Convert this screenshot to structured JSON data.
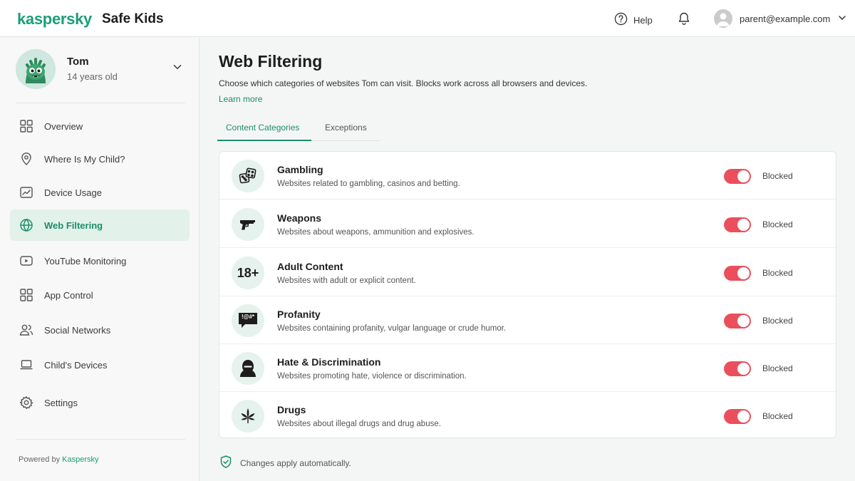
{
  "header": {
    "brand": "kaspersky",
    "product": "Safe Kids",
    "help_label": "Help",
    "account_email": "parent@example.com"
  },
  "child": {
    "name": "Tom",
    "age": "14 years old"
  },
  "nav": [
    {
      "label": "Overview",
      "icon": "grid-icon",
      "active": false
    },
    {
      "label": "Where Is My Child?",
      "icon": "location-pin-icon",
      "active": false
    },
    {
      "label": "Device Usage",
      "icon": "chart-line-icon",
      "active": false
    },
    {
      "label": "Web Filtering",
      "icon": "globe-icon",
      "active": true
    },
    {
      "label": "YouTube Monitoring",
      "icon": "youtube-icon",
      "active": false
    },
    {
      "label": "App Control",
      "icon": "apps-grid-icon",
      "active": false
    },
    {
      "label": "Social Networks",
      "icon": "users-icon",
      "active": false
    },
    {
      "label": "Child's Devices",
      "icon": "laptop-icon",
      "active": false
    },
    {
      "label": "Settings",
      "icon": "gear-icon",
      "active": false
    }
  ],
  "footer": {
    "powered_prefix": "Powered by",
    "powered_brand": "Kaspersky"
  },
  "main": {
    "title": "Web Filtering",
    "description": "Choose which categories of websites Tom can visit. Blocks work across all browsers and devices.",
    "learn_more": "Learn more",
    "tabs": [
      {
        "label": "Content Categories",
        "active": true
      },
      {
        "label": "Exceptions",
        "active": false
      }
    ],
    "categories": [
      {
        "title": "Gambling",
        "description": "Websites related to gambling, casinos and betting.",
        "status": "Blocked",
        "icon": "dice-icon",
        "enabled": true
      },
      {
        "title": "Weapons",
        "description": "Websites about weapons, ammunition and explosives.",
        "status": "Blocked",
        "icon": "pistol-icon",
        "enabled": true
      },
      {
        "title": "Adult Content",
        "description": "Websites with adult or explicit content.",
        "status": "Blocked",
        "icon": "18-plus-icon",
        "icon_text": "18+",
        "enabled": true
      },
      {
        "title": "Profanity",
        "description": "Websites containing profanity, vulgar language or crude humor.",
        "status": "Blocked",
        "icon": "speech-bubble-icon",
        "icon_text": "!@#*",
        "enabled": true
      },
      {
        "title": "Hate & Discrimination",
        "description": "Websites promoting hate, violence or discrimination.",
        "status": "Blocked",
        "icon": "hooded-person-icon",
        "enabled": true
      },
      {
        "title": "Drugs",
        "description": "Websites about illegal drugs and drug abuse.",
        "status": "Blocked",
        "icon": "cannabis-leaf-icon",
        "enabled": true
      }
    ],
    "footer_note": "Changes apply automatically."
  },
  "colors": {
    "accent": "#1b8e6c",
    "toggle_on": "#ea4f5b",
    "active_nav_bg": "#e2f1ea"
  }
}
